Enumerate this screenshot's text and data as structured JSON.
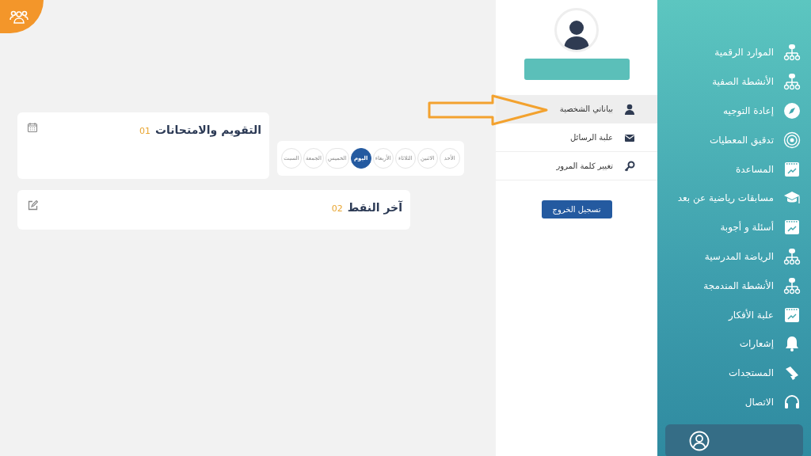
{
  "sidebar": {
    "items": [
      {
        "label": "الموارد الرقمية",
        "kind": "network"
      },
      {
        "label": "الأنشطة الصفية",
        "kind": "network"
      },
      {
        "label": "إعادة التوجيه",
        "kind": "compass"
      },
      {
        "label": "تدقيق المعطيات",
        "kind": "radar"
      },
      {
        "label": "المساعدة",
        "kind": "calendar"
      },
      {
        "label": "مسابقات رياضية عن بعد",
        "kind": "cap"
      },
      {
        "label": "أسئلة و أجوبة",
        "kind": "calendar"
      },
      {
        "label": "الرياضة المدرسية",
        "kind": "network"
      },
      {
        "label": "الأنشطة المندمجة",
        "kind": "network"
      },
      {
        "label": "علبة الأفكار",
        "kind": "calendar"
      },
      {
        "label": "إشعارات",
        "kind": "bell"
      },
      {
        "label": "المستجدات",
        "kind": "megaphone"
      },
      {
        "label": "الاتصال",
        "kind": "headset"
      }
    ]
  },
  "profile": {
    "menu": [
      {
        "label": "بياناتي الشخصية",
        "kind": "user",
        "selected": true
      },
      {
        "label": "علبة الرسائل",
        "kind": "envelope",
        "selected": false
      },
      {
        "label": "تغيير كلمة المرور",
        "kind": "key",
        "selected": false
      }
    ],
    "logout_button": "تسجيل الخروج"
  },
  "cards": [
    {
      "title": "التقويم والامتحانات",
      "number": "01",
      "kind": "calendar"
    },
    {
      "title": "آخر النقط",
      "number": "02",
      "kind": "edit"
    }
  ],
  "days": [
    {
      "label": "الأحد",
      "selected": false
    },
    {
      "label": "الاثنين",
      "selected": false
    },
    {
      "label": "الثلاثاء",
      "selected": false
    },
    {
      "label": "الأربعاء",
      "selected": false
    },
    {
      "label": "اليوم",
      "selected": true
    },
    {
      "label": "الخميس",
      "selected": false
    },
    {
      "label": "الجمعة",
      "selected": false
    },
    {
      "label": "السبت",
      "selected": false
    }
  ]
}
